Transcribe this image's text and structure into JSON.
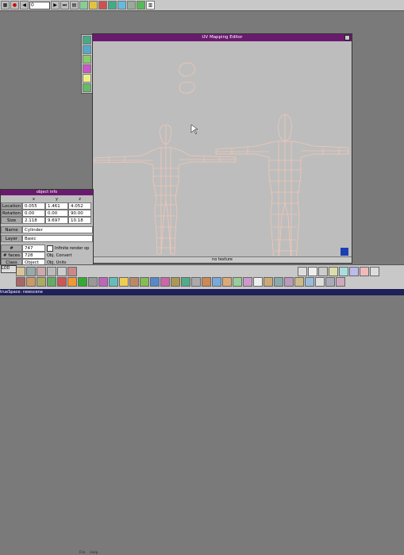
{
  "toolbar": {
    "frame_value": "0",
    "buttons": [
      "grid-icon",
      "record-icon",
      "rewind-icon",
      "play-icon",
      "fastforward-icon",
      "end-icon",
      "film-icon",
      "tools-icon",
      "render-icon",
      "folder-icon",
      "paint-icon",
      "material-icon",
      "camera-icon",
      "light-icon",
      "chart-icon"
    ]
  },
  "uv_editor": {
    "title": "UV Mapping Editor",
    "status": "no texture"
  },
  "object_info": {
    "title": "object info",
    "columns": [
      "x",
      "y",
      "z"
    ],
    "rows": [
      {
        "label": "Location",
        "values": [
          "0.055",
          "1.461",
          "4.052"
        ]
      },
      {
        "label": "Rotation",
        "values": [
          "0.00",
          "0.00",
          "90.00"
        ]
      },
      {
        "label": "Size",
        "values": [
          "2.118",
          "9.697",
          "10.18"
        ]
      }
    ],
    "name_label": "Name",
    "name_value": "Cylinder",
    "layer_label": "Layer",
    "layer_value": "Basic",
    "vertices_label": "# vertices",
    "vertices_value": "747",
    "faces_label": "# faces",
    "faces_value": "728",
    "class_label": "Class",
    "class_value": "Object",
    "inbound_label": "Infinite render op",
    "convert_label": "Obj. Convert",
    "units_label": "Obj. Units"
  },
  "bottom": {
    "lod": "LOD",
    "taskbar": "trueSpace: newscene",
    "menu": [
      "File",
      "Help"
    ]
  },
  "colors": {
    "title_purple": "#6a1a6e",
    "mesh_stroke": "#f2c7b6",
    "corner_blue": "#1b3fb0"
  }
}
